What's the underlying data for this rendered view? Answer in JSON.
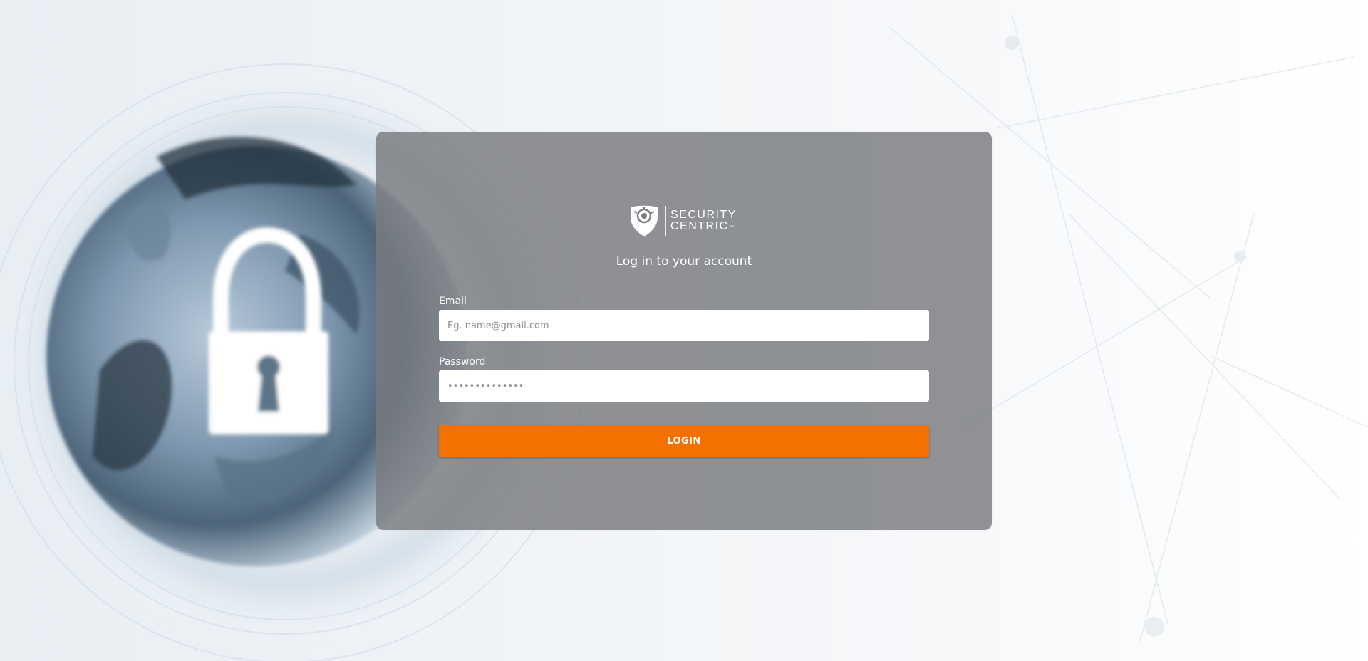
{
  "brand": {
    "line1": "SECURITY",
    "line2": "CENTRIC",
    "suffix": "INC",
    "logo_icon": "shield-icon"
  },
  "login": {
    "title": "Log in to your account",
    "email_label": "Email",
    "email_placeholder": "Eg. name@gmail.com",
    "password_label": "Password",
    "password_value": "••••••••••••••",
    "login_label": "LOGIN"
  },
  "colors": {
    "accent": "#f47100",
    "card": "#787a7e"
  },
  "background": {
    "icon": "padlock-globe-background"
  }
}
